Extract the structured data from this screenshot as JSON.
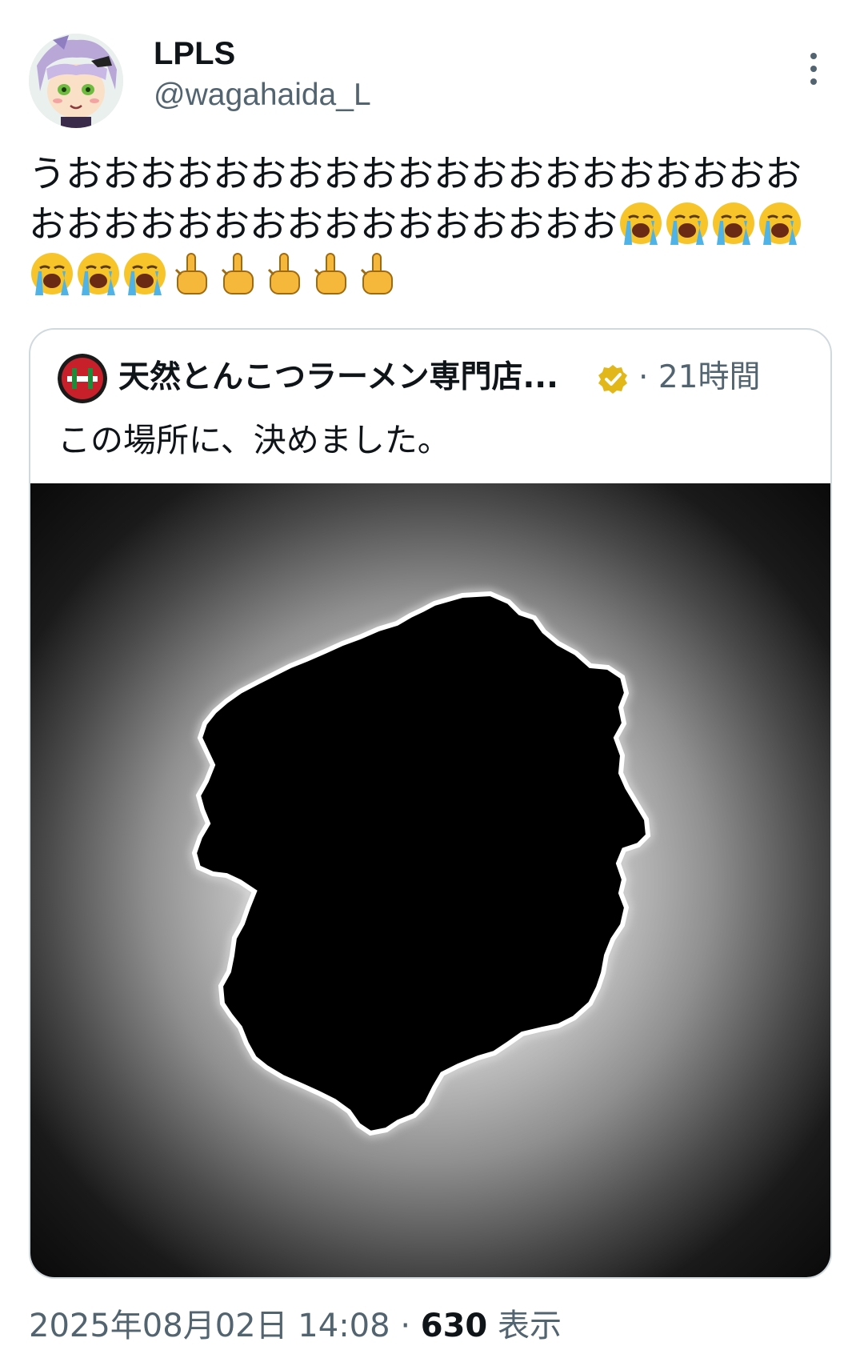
{
  "author": {
    "display_name": "LPLS",
    "handle": "@wagahaida_L",
    "avatar_icon": "anime-avatar-icon"
  },
  "tweet": {
    "text": "うおおおおおおおおおおおおおおおおおおおおおおおおおおおおおおおおおおおお",
    "emoji_sequence": [
      "loudly-crying-face-emoji",
      "loudly-crying-face-emoji",
      "loudly-crying-face-emoji",
      "loudly-crying-face-emoji",
      "loudly-crying-face-emoji",
      "loudly-crying-face-emoji",
      "loudly-crying-face-emoji",
      "pointing-up-hand-emoji",
      "pointing-up-hand-emoji",
      "pointing-up-hand-emoji",
      "pointing-up-hand-emoji",
      "pointing-up-hand-emoji"
    ]
  },
  "quote": {
    "author_name": "天然とんこつラーメン専門店...",
    "verified_icon": "verified-badge-icon",
    "separator": "·",
    "time_ago": "21時間",
    "text": "この場所に、決めました。",
    "media_icon": "map-silhouette-image"
  },
  "footer": {
    "date_time": "2025年08月02日 14:08",
    "separator": "·",
    "views_count": "630",
    "views_label": "表示"
  },
  "colors": {
    "text_primary": "#0f1419",
    "text_secondary": "#536471",
    "border": "#cfd9de",
    "verified_gold": "#e2b719"
  }
}
